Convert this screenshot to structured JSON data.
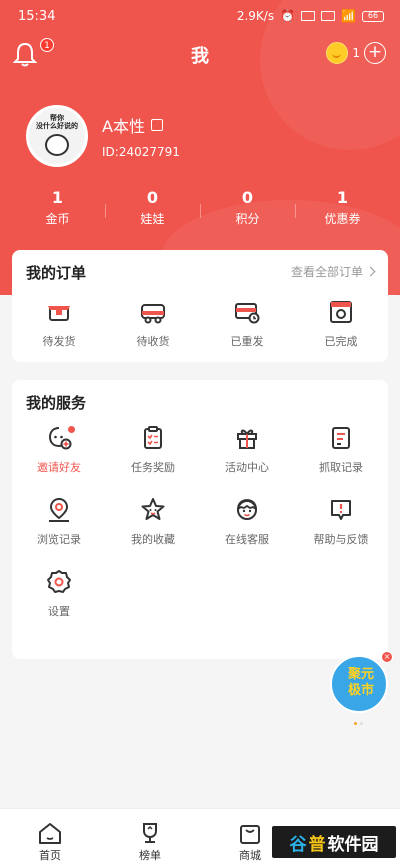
{
  "status_bar": {
    "time": "15:34",
    "speed": "2.9K/s",
    "battery": "66"
  },
  "header": {
    "title": "我",
    "notification_count": "1",
    "coin_count": "1"
  },
  "profile": {
    "name": "A本性",
    "id": "ID:24027791",
    "avatar_caption": "帮你\n没什么好说的"
  },
  "stats": [
    {
      "value": "1",
      "label": "金币"
    },
    {
      "value": "0",
      "label": "娃娃"
    },
    {
      "value": "0",
      "label": "积分"
    },
    {
      "value": "1",
      "label": "优惠券"
    }
  ],
  "orders": {
    "title": "我的订单",
    "view_all": "查看全部订单",
    "items": [
      {
        "label": "待发货",
        "icon": "package-icon"
      },
      {
        "label": "待收货",
        "icon": "truck-icon"
      },
      {
        "label": "已重发",
        "icon": "resend-icon"
      },
      {
        "label": "已完成",
        "icon": "completed-icon"
      }
    ]
  },
  "services": {
    "title": "我的服务",
    "items": [
      {
        "label": "邀请好友",
        "icon": "invite-friend-icon"
      },
      {
        "label": "任务奖励",
        "icon": "task-reward-icon"
      },
      {
        "label": "活动中心",
        "icon": "gift-icon"
      },
      {
        "label": "抓取记录",
        "icon": "record-icon"
      },
      {
        "label": "浏览记录",
        "icon": "location-icon"
      },
      {
        "label": "我的收藏",
        "icon": "star-icon"
      },
      {
        "label": "在线客服",
        "icon": "service-face-icon"
      },
      {
        "label": "帮助与反馈",
        "icon": "feedback-icon"
      },
      {
        "label": "设置",
        "icon": "settings-icon"
      }
    ]
  },
  "promo": {
    "text": "聚元\n极市"
  },
  "tabbar": [
    {
      "label": "首页",
      "icon": "home-icon"
    },
    {
      "label": "榜单",
      "icon": "trophy-icon"
    },
    {
      "label": "商城",
      "icon": "shop-icon"
    }
  ],
  "watermark": {
    "part1": "谷",
    "part2": "普",
    "part3": "软件园"
  },
  "colors": {
    "brand": "#f0554d",
    "background": "#f5f5f5"
  }
}
